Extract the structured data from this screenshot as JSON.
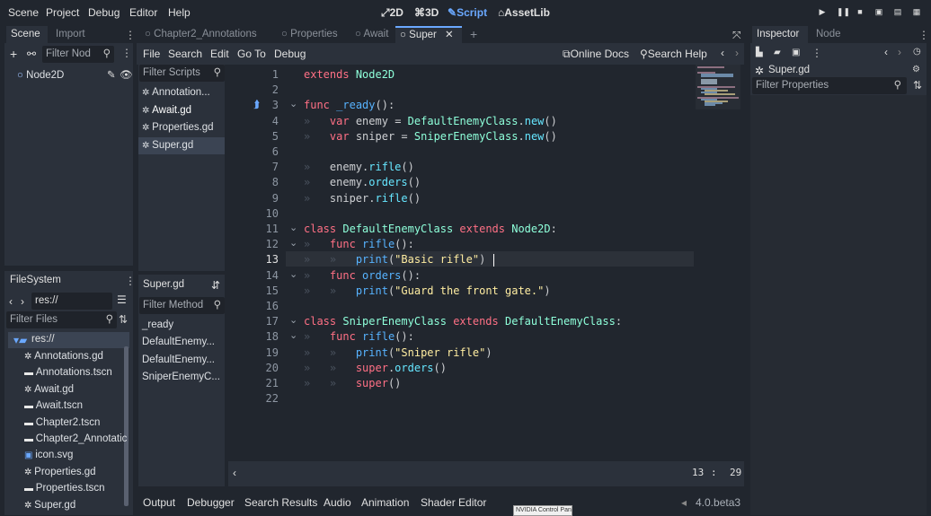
{
  "menubar": {
    "menus": [
      "Scene",
      "Project",
      "Debug",
      "Editor",
      "Help"
    ],
    "modes": [
      "2D",
      "3D",
      "Script",
      "AssetLib"
    ],
    "active_mode": "Script"
  },
  "scene_dock": {
    "tabs": [
      "Scene",
      "Import"
    ],
    "filter_placeholder": "Filter Nod",
    "root_node": "Node2D"
  },
  "filesystem": {
    "title": "FileSystem",
    "path": "res://",
    "filter_placeholder": "Filter Files",
    "root": "res://",
    "files": [
      "Annotations.gd",
      "Annotations.tscn",
      "Await.gd",
      "Await.tscn",
      "Chapter2.tscn",
      "Chapter2_Annotatic",
      "icon.svg",
      "Properties.gd",
      "Properties.tscn",
      "Super.gd"
    ]
  },
  "editor_tabs": [
    "Chapter2_Annotations",
    "Properties",
    "Await",
    "Super"
  ],
  "script_menu": [
    "File",
    "Search",
    "Edit",
    "Go To",
    "Debug"
  ],
  "script_toolbar": {
    "online_docs": "Online Docs",
    "search_help": "Search Help"
  },
  "script_list": {
    "filter_placeholder": "Filter Scripts",
    "items": [
      "Annotation...",
      "Await.gd",
      "Properties.gd",
      "Super.gd"
    ],
    "current": "Super.gd"
  },
  "method_list": {
    "filter_placeholder": "Filter Method",
    "items": [
      "_ready",
      "DefaultEnemy...",
      "DefaultEnemy...",
      "SniperEnemyC..."
    ]
  },
  "code_lines": [
    "extends Node2D",
    "",
    "func _ready():",
    "    var enemy = DefaultEnemyClass.new()",
    "    var sniper = SniperEnemyClass.new()",
    "",
    "    enemy.rifle()",
    "    enemy.orders()",
    "    sniper.rifle()",
    "",
    "class DefaultEnemyClass extends Node2D:",
    "    func rifle():",
    "        print(\"Basic rifle\")",
    "    func orders():",
    "        print(\"Guard the front gate.\")",
    "",
    "class SniperEnemyClass extends DefaultEnemyClass:",
    "    func rifle():",
    "        print(\"Sniper rifle\")",
    "        super.orders()",
    "        super()",
    ""
  ],
  "status": {
    "line": "13",
    "sep": ":",
    "col": "29"
  },
  "bottom_panel": {
    "tabs": [
      "Output",
      "Debugger",
      "Search Results",
      "Audio",
      "Animation",
      "Shader Editor"
    ],
    "version": "4.0.beta3",
    "tooltip": "NVIDIA Control Panel"
  },
  "inspector": {
    "tabs": [
      "Inspector",
      "Node"
    ],
    "current_file": "Super.gd",
    "filter_placeholder": "Filter Properties"
  }
}
